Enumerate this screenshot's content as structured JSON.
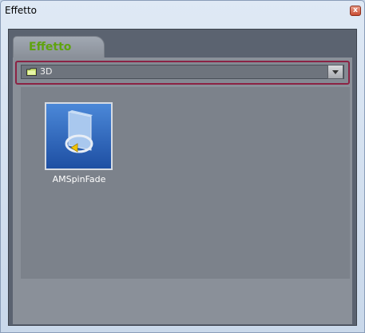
{
  "window": {
    "title": "Effetto",
    "close_symbol": "x"
  },
  "tabs": [
    {
      "label": "Effetto",
      "active": true
    }
  ],
  "category": {
    "icon": "folder-icon",
    "value": "3D"
  },
  "effects": [
    {
      "label": "AMSpinFade",
      "icon": "spin-fade-icon"
    }
  ],
  "colors": {
    "tab_text": "#5fa30f",
    "highlight_border": "#8b2344",
    "thumb_blue": "#2f6bc2"
  }
}
